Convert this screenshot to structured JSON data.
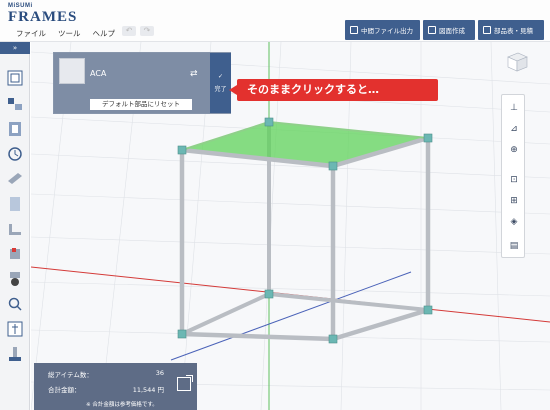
{
  "app": {
    "logo_brand": "MiSUMi",
    "logo_product": "FRAMES",
    "menu": [
      "ファイル",
      "ツール",
      "ヘルプ"
    ]
  },
  "header_buttons": [
    {
      "label": "中間ファイル出力",
      "icon": "export-icon"
    },
    {
      "label": "図面作成",
      "icon": "drawing-icon"
    },
    {
      "label": "部品表・見積",
      "icon": "cart-icon"
    }
  ],
  "sidebar": {
    "toggle": "»",
    "items": [
      "frame-catalog-icon",
      "assembly-icon",
      "profile-icon",
      "history-icon",
      "beam-icon",
      "panel-icon",
      "bracket-icon",
      "joint-icon",
      "caster-icon",
      "search-icon",
      "measure-icon",
      "adjuster-icon"
    ]
  },
  "part_panel": {
    "name": "ACA",
    "reset_label": "デフォルト部品にリセット",
    "done_label": "完了"
  },
  "callout": {
    "text": "そのままクリックすると…"
  },
  "right_toolbar": [
    "align-icon",
    "section-icon",
    "zoom-icon",
    "fit-icon",
    "fit-all-icon",
    "iso-view-icon",
    "layers-icon"
  ],
  "summary": {
    "items_label": "総アイテム数：",
    "items_value": "36",
    "total_label": "合計金額：",
    "total_value": "11,544 円",
    "note": "※ 合計金額は参考価格です。"
  },
  "colors": {
    "primary": "#3f5f8e",
    "panel": "#7e8da5",
    "callout": "#e3312e",
    "highlight": "#5fd35a",
    "frame": "#b9bdc3",
    "connector": "#6bb7b3"
  }
}
